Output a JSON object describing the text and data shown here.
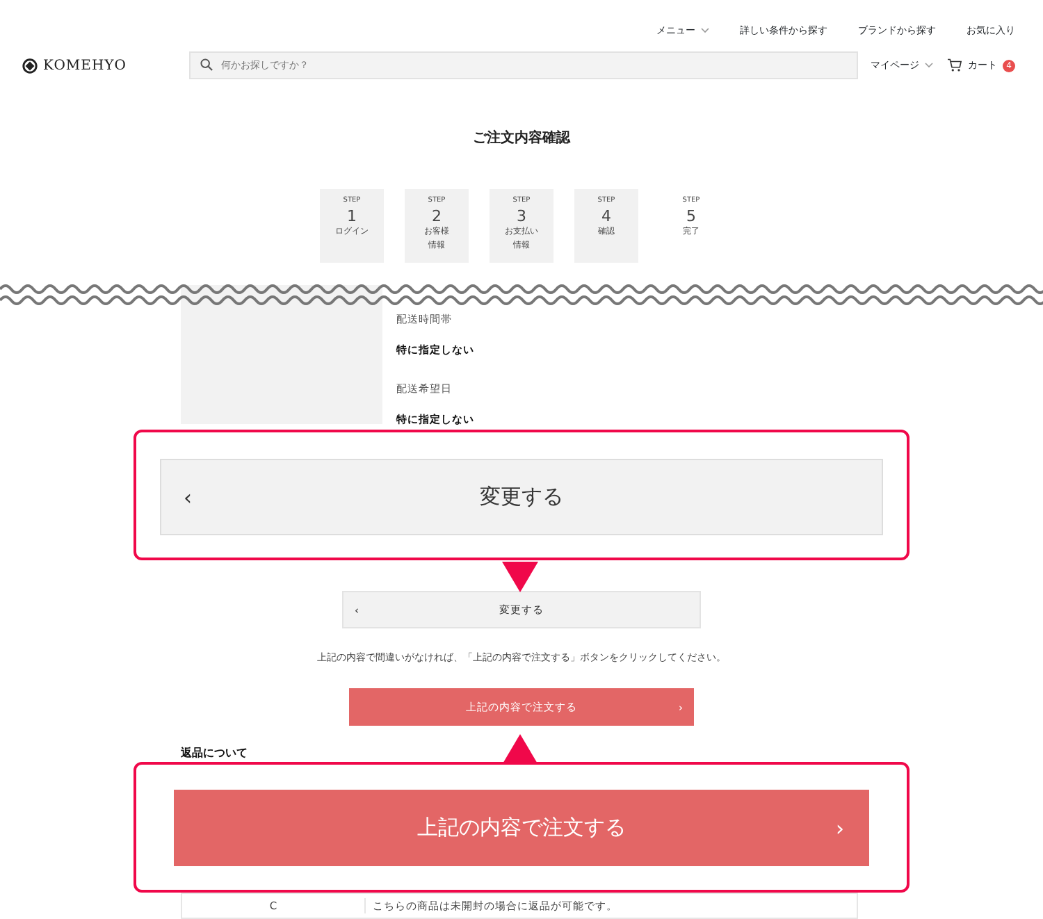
{
  "top_links": [
    {
      "label": "メニュー",
      "dropdown": true
    },
    {
      "label": "詳しい条件から探す",
      "dropdown": false
    },
    {
      "label": "ブランドから探す",
      "dropdown": false
    },
    {
      "label": "お気に入り",
      "dropdown": false
    }
  ],
  "logo": "KOMEHYO",
  "search": {
    "placeholder": "何かお探しですか？"
  },
  "account": {
    "label": "マイページ",
    "dropdown": true
  },
  "cart": {
    "label": "カート",
    "count": "4"
  },
  "title": "ご注文内容確認",
  "steps": [
    {
      "caption": "STEP",
      "number": "1",
      "label_lines": [
        "ログイン"
      ],
      "reached": true
    },
    {
      "caption": "STEP",
      "number": "2",
      "label_lines": [
        "お客様",
        "情報"
      ],
      "reached": true
    },
    {
      "caption": "STEP",
      "number": "3",
      "label_lines": [
        "お支払い",
        "情報"
      ],
      "reached": true
    },
    {
      "caption": "STEP",
      "number": "4",
      "label_lines": [
        "確認"
      ],
      "reached": true
    },
    {
      "caption": "STEP",
      "number": "5",
      "label_lines": [
        "完了"
      ],
      "reached": false
    }
  ],
  "delivery": [
    {
      "label": "配送時間帯",
      "value": "特に指定しない"
    },
    {
      "label": "配送希望日",
      "value": "特に指定しない"
    }
  ],
  "change_button": {
    "icon": "‹",
    "label": "変更する"
  },
  "instruction": "上記の内容で間違いがなければ、「上記の内容で注文する」ボタンをクリックしてください。",
  "order_button": {
    "label": "上記の内容で注文する",
    "icon": "›"
  },
  "returns": {
    "heading": "返品について",
    "rows": [
      {
        "column_1": "C",
        "column_2": "こちらの商品は未開封の場合に返品が可能です。"
      }
    ]
  },
  "callouts": [
    {
      "kind": "change",
      "icon": "‹",
      "label": "変更する"
    },
    {
      "kind": "order",
      "label": "上記の内容で注文する",
      "icon": "›"
    }
  ]
}
